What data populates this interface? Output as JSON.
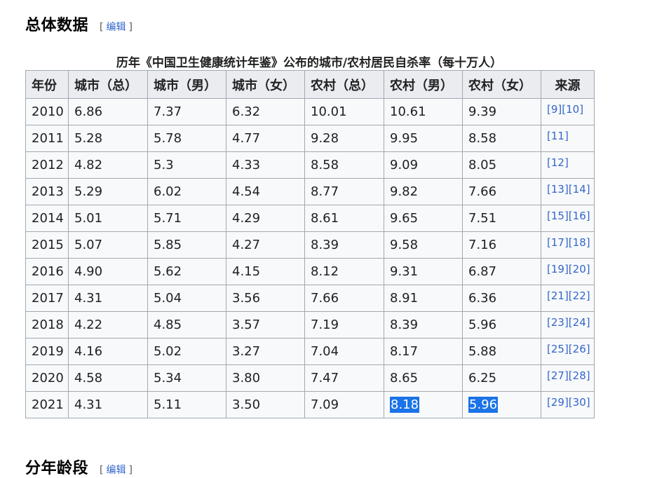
{
  "headings": {
    "overall": "总体数据",
    "age": "分年龄段"
  },
  "edit": {
    "open": "[",
    "label": "编辑",
    "close": "]"
  },
  "table": {
    "caption": "历年《中国卫生健康统计年鉴》公布的城市/农村居民自杀率（每十万人）",
    "headers": [
      "年份",
      "城市（总）",
      "城市（男）",
      "城市（女）",
      "农村（总）",
      "农村（男）",
      "农村（女）",
      "来源"
    ],
    "rows": [
      {
        "year": "2010",
        "c_total": "6.86",
        "c_male": "7.37",
        "c_female": "6.32",
        "r_total": "10.01",
        "r_male": "10.61",
        "r_female": "9.39",
        "refs": [
          "[9]",
          "[10]"
        ]
      },
      {
        "year": "2011",
        "c_total": "5.28",
        "c_male": "5.78",
        "c_female": "4.77",
        "r_total": "9.28",
        "r_male": "9.95",
        "r_female": "8.58",
        "refs": [
          "[11]"
        ]
      },
      {
        "year": "2012",
        "c_total": "4.82",
        "c_male": "5.3",
        "c_female": "4.33",
        "r_total": "8.58",
        "r_male": "9.09",
        "r_female": "8.05",
        "refs": [
          "[12]"
        ]
      },
      {
        "year": "2013",
        "c_total": "5.29",
        "c_male": "6.02",
        "c_female": "4.54",
        "r_total": "8.77",
        "r_male": "9.82",
        "r_female": "7.66",
        "refs": [
          "[13]",
          "[14]"
        ]
      },
      {
        "year": "2014",
        "c_total": "5.01",
        "c_male": "5.71",
        "c_female": "4.29",
        "r_total": "8.61",
        "r_male": "9.65",
        "r_female": "7.51",
        "refs": [
          "[15]",
          "[16]"
        ]
      },
      {
        "year": "2015",
        "c_total": "5.07",
        "c_male": "5.85",
        "c_female": "4.27",
        "r_total": "8.39",
        "r_male": "9.58",
        "r_female": "7.16",
        "refs": [
          "[17]",
          "[18]"
        ]
      },
      {
        "year": "2016",
        "c_total": "4.90",
        "c_male": "5.62",
        "c_female": "4.15",
        "r_total": "8.12",
        "r_male": "9.31",
        "r_female": "6.87",
        "refs": [
          "[19]",
          "[20]"
        ]
      },
      {
        "year": "2017",
        "c_total": "4.31",
        "c_male": "5.04",
        "c_female": "3.56",
        "r_total": "7.66",
        "r_male": "8.91",
        "r_female": "6.36",
        "refs": [
          "[21]",
          "[22]"
        ]
      },
      {
        "year": "2018",
        "c_total": "4.22",
        "c_male": "4.85",
        "c_female": "3.57",
        "r_total": "7.19",
        "r_male": "8.39",
        "r_female": "5.96",
        "refs": [
          "[23]",
          "[24]"
        ]
      },
      {
        "year": "2019",
        "c_total": "4.16",
        "c_male": "5.02",
        "c_female": "3.27",
        "r_total": "7.04",
        "r_male": "8.17",
        "r_female": "5.88",
        "refs": [
          "[25]",
          "[26]"
        ]
      },
      {
        "year": "2020",
        "c_total": "4.58",
        "c_male": "5.34",
        "c_female": "3.80",
        "r_total": "7.47",
        "r_male": "8.65",
        "r_female": "6.25",
        "refs": [
          "[27]",
          "[28]"
        ]
      },
      {
        "year": "2021",
        "c_total": "4.31",
        "c_male": "5.11",
        "c_female": "3.50",
        "r_total": "7.09",
        "r_male": "8.18",
        "r_female": "5.96",
        "refs": [
          "[29]",
          "[30]"
        ]
      }
    ]
  }
}
